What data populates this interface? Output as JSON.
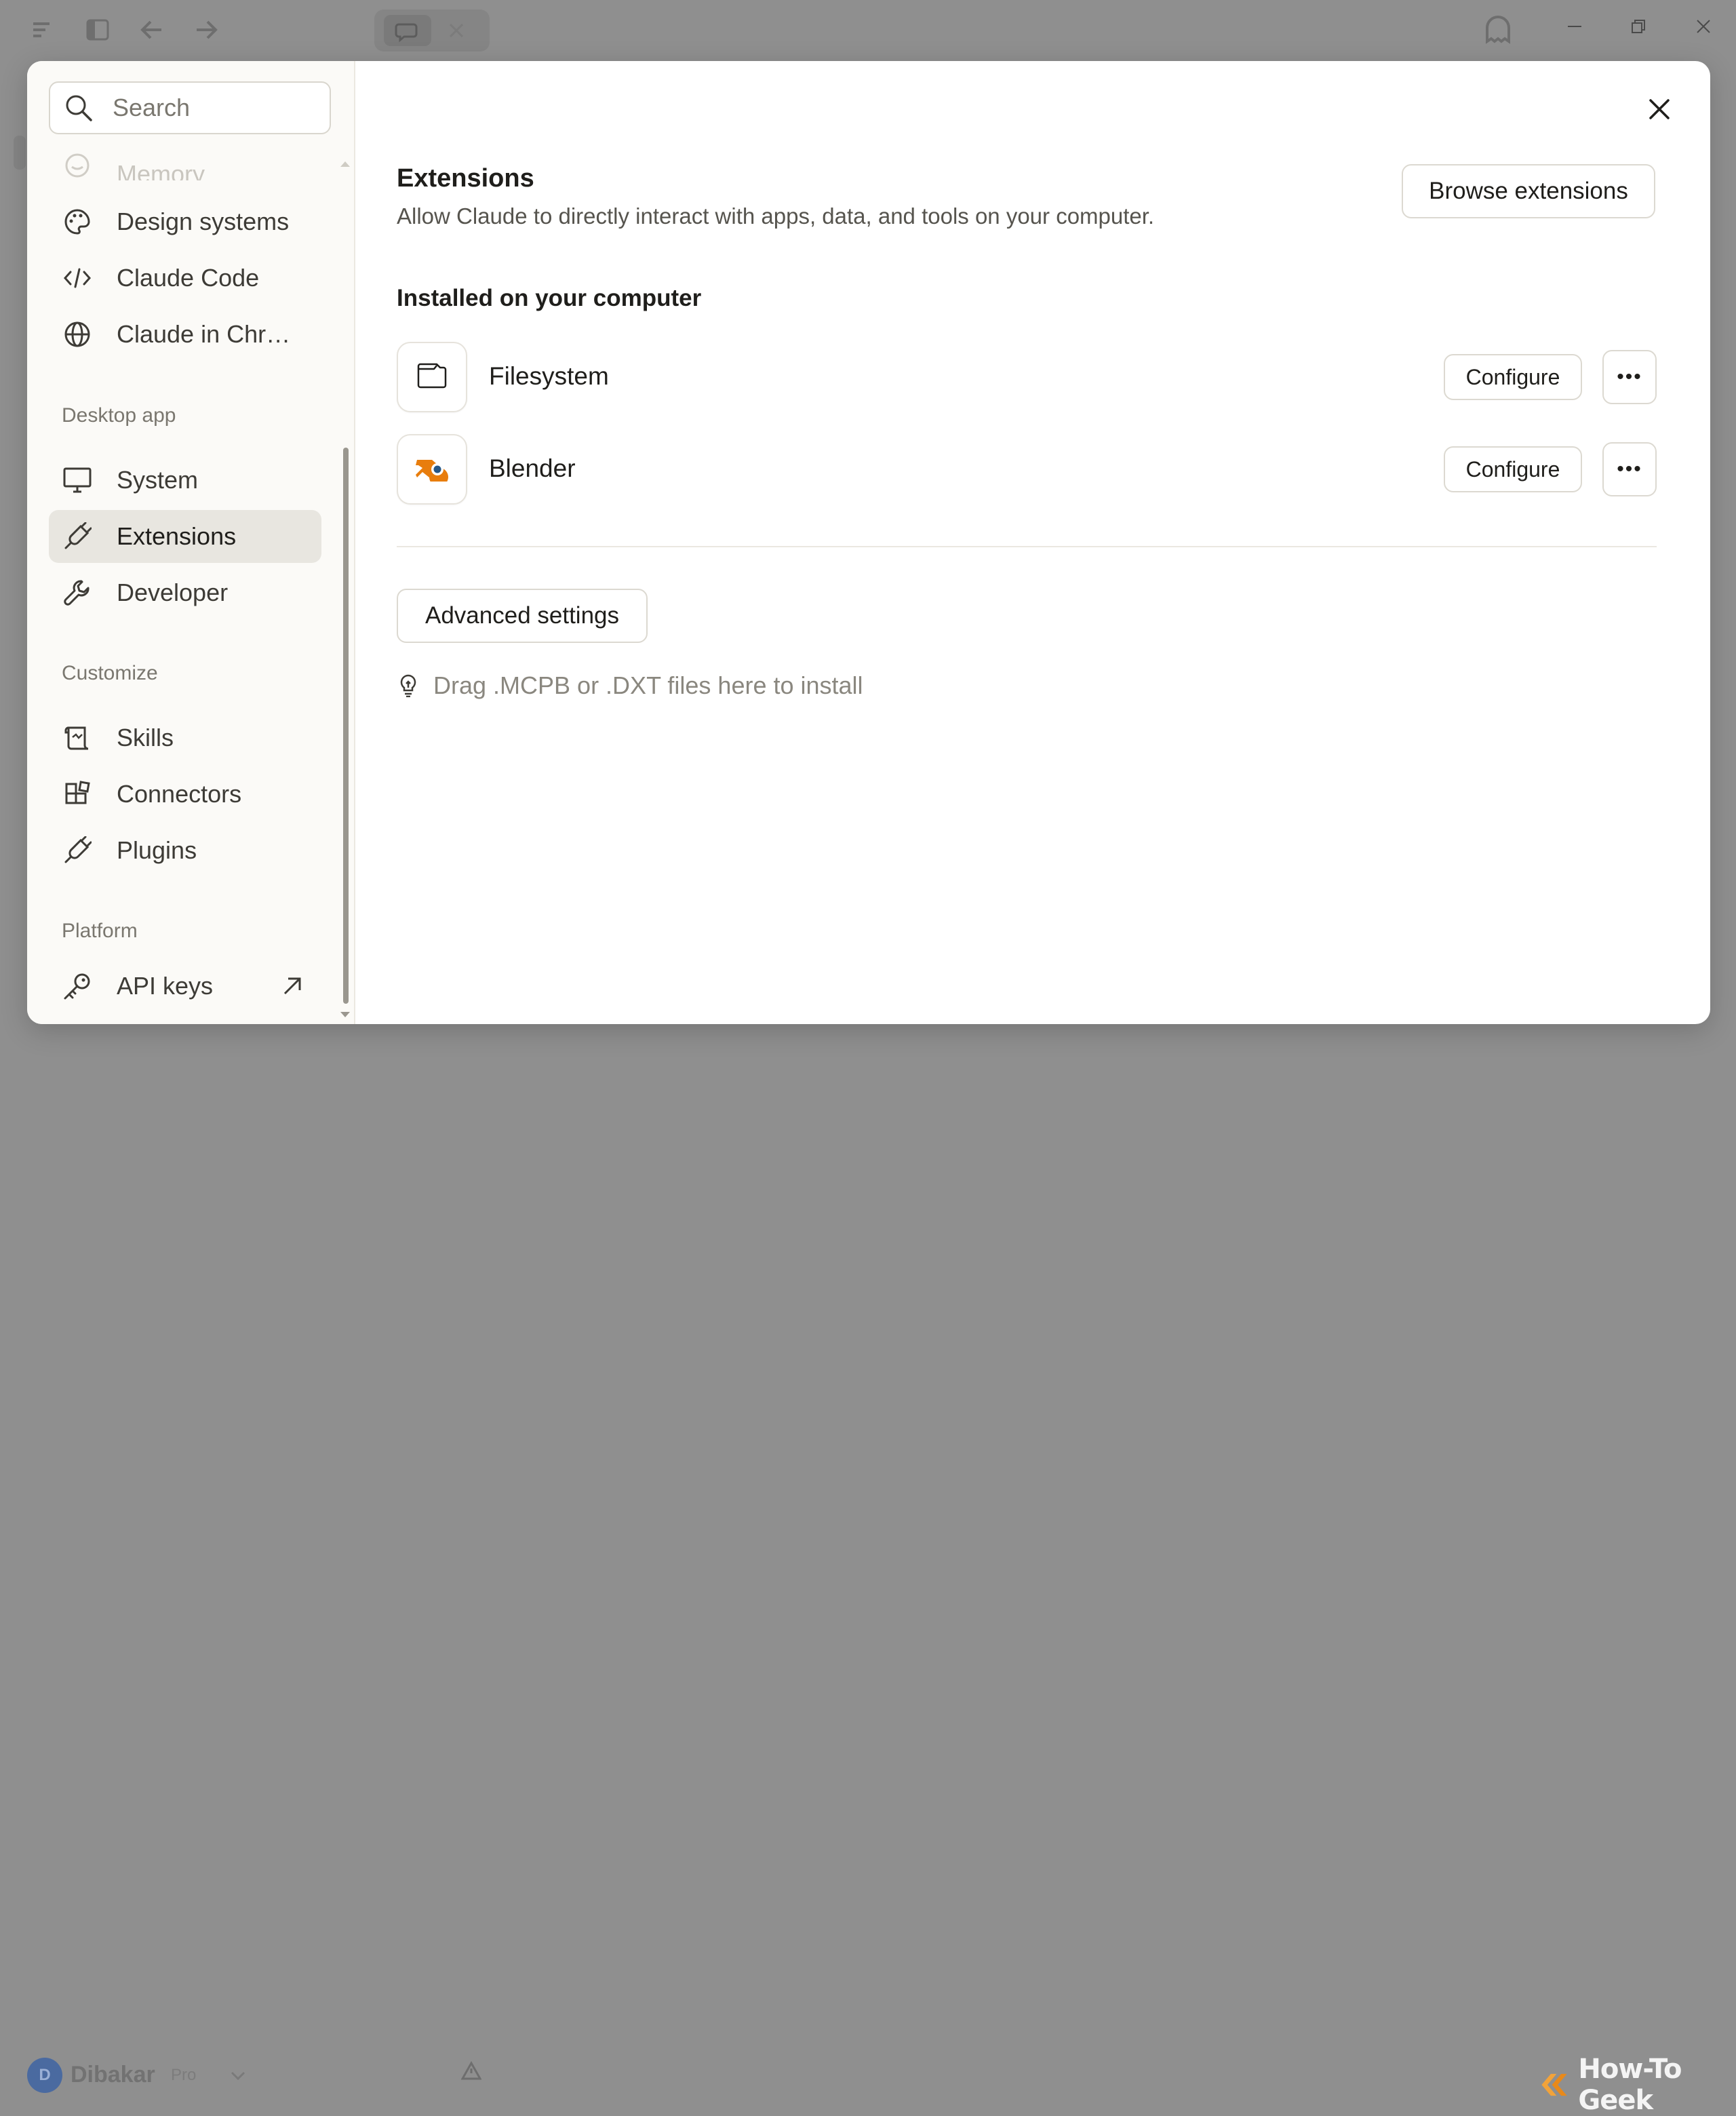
{
  "background": {
    "user_name": "Dibakar",
    "user_plan": "Pro",
    "avatar_initial": "D",
    "watermark": "How-To Geek"
  },
  "search": {
    "placeholder": "Search"
  },
  "sidebar": {
    "items_top": [
      {
        "label": "Memory",
        "icon": "memory-icon"
      },
      {
        "label": "Design systems",
        "icon": "palette-icon"
      },
      {
        "label": "Claude Code",
        "icon": "code-icon"
      },
      {
        "label": "Claude in Chr…",
        "icon": "globe-icon"
      }
    ],
    "sections": [
      {
        "label": "Desktop app",
        "items": [
          {
            "label": "System",
            "icon": "monitor-icon"
          },
          {
            "label": "Extensions",
            "icon": "plug-icon",
            "active": true
          },
          {
            "label": "Developer",
            "icon": "wrench-icon"
          }
        ]
      },
      {
        "label": "Customize",
        "items": [
          {
            "label": "Skills",
            "icon": "scroll-icon"
          },
          {
            "label": "Connectors",
            "icon": "blocks-icon"
          },
          {
            "label": "Plugins",
            "icon": "plug-icon"
          }
        ]
      },
      {
        "label": "Platform",
        "items": [
          {
            "label": "API keys",
            "icon": "key-icon",
            "external": true
          }
        ]
      }
    ]
  },
  "main": {
    "title": "Extensions",
    "description": "Allow Claude to directly interact with apps, data, and tools on your computer.",
    "browse_label": "Browse extensions",
    "installed_title": "Installed on your computer",
    "extensions": [
      {
        "name": "Filesystem",
        "icon": "folder-icon",
        "configure_label": "Configure",
        "more_label": "•••"
      },
      {
        "name": "Blender",
        "icon": "blender-logo-icon",
        "configure_label": "Configure",
        "more_label": "•••"
      }
    ],
    "advanced_label": "Advanced settings",
    "hint": "Drag .MCPB or .DXT files here to install"
  },
  "colors": {
    "overlay": "#8f8f8f",
    "sidebar_bg": "#fbfaf7",
    "active_item_bg": "#e8e6e0",
    "blender_orange": "#e87d0d",
    "blender_blue": "#265787"
  }
}
